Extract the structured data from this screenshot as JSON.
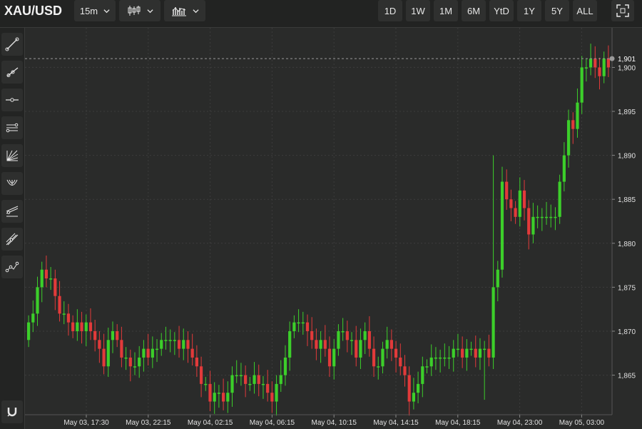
{
  "toolbar": {
    "symbol": "XAU/USD",
    "interval": "15m",
    "ranges": [
      "1D",
      "1W",
      "1M",
      "6M",
      "YtD",
      "1Y",
      "5Y",
      "ALL"
    ]
  },
  "left_tools": [
    "trend-line",
    "ray-line",
    "horizontal-line",
    "parallel-channel",
    "fib-fan",
    "pitchfork",
    "fib-retracement",
    "regression-channel",
    "path-tool",
    "magnet"
  ],
  "colors": {
    "up": "#3ccf2a",
    "down": "#e23a3a",
    "background": "#2a2b2a"
  },
  "chart_data": {
    "type": "candlestick",
    "y_axis": {
      "min": 1860.5,
      "max": 1904.5,
      "ticks": [
        1865,
        1870,
        1875,
        1880,
        1885,
        1890,
        1895,
        1900,
        1901
      ],
      "tick_labels": [
        "1,865",
        "1,870",
        "1,875",
        "1,880",
        "1,885",
        "1,890",
        "1,895",
        "1,900",
        "1,901"
      ]
    },
    "current_price": 1901,
    "x_tick_labels": [
      "May 03, 17:30",
      "May 03, 22:15",
      "May 04, 02:15",
      "May 04, 06:15",
      "May 04, 10:15",
      "May 04, 14:15",
      "May 04, 18:15",
      "May 04, 23:00",
      "May 05, 03:00"
    ],
    "closes": [
      1871,
      1872,
      1875,
      1877,
      1876,
      1876,
      1874,
      1872,
      1872,
      1871,
      1870,
      1871,
      1870,
      1871,
      1870,
      1869,
      1868,
      1866,
      1869,
      1870,
      1869,
      1867,
      1867,
      1866,
      1866,
      1867,
      1868,
      1867,
      1868,
      1868,
      1869,
      1869,
      1869,
      1869,
      1868,
      1869,
      1868,
      1867,
      1866,
      1864,
      1864,
      1862,
      1863,
      1863,
      1862,
      1863,
      1865,
      1865,
      1865,
      1864,
      1864,
      1865,
      1864,
      1864,
      1863,
      1862,
      1864,
      1865,
      1867,
      1870,
      1871,
      1871,
      1871,
      1870,
      1869,
      1868,
      1869,
      1868,
      1866,
      1868,
      1870,
      1870,
      1869,
      1869,
      1867,
      1869,
      1870,
      1868,
      1866,
      1866,
      1868,
      1869,
      1868,
      1867,
      1866,
      1865,
      1862,
      1863,
      1864,
      1866,
      1866,
      1867,
      1867,
      1867,
      1867,
      1867,
      1868,
      1868,
      1867,
      1868,
      1868,
      1867,
      1868,
      1868,
      1867,
      1875,
      1877,
      1887,
      1885,
      1884,
      1883,
      1886,
      1884,
      1881,
      1883,
      1883,
      1883,
      1883,
      1883,
      1883,
      1887,
      1890,
      1894,
      1893,
      1896,
      1900,
      1900,
      1901,
      1900,
      1899,
      1901,
      1900
    ]
  }
}
